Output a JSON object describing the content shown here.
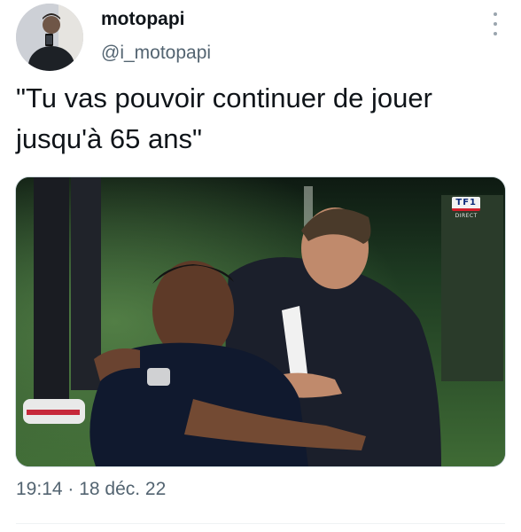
{
  "author": {
    "display_name": "motopapi",
    "handle": "@i_motopapi"
  },
  "tweet": {
    "text": "\"Tu vas pouvoir continuer de jouer jusqu'à 65 ans\""
  },
  "media": {
    "channel_logo_text": "TF1",
    "channel_logo_sub": "DIRECT"
  },
  "meta": {
    "timestamp": "19:14 · 18 déc. 22"
  },
  "icons": {
    "more": "more-vertical-icon",
    "channel": "tf1-logo-icon"
  },
  "colors": {
    "text_primary": "#0f1419",
    "text_secondary": "#536471",
    "border": "#cfd9de"
  }
}
